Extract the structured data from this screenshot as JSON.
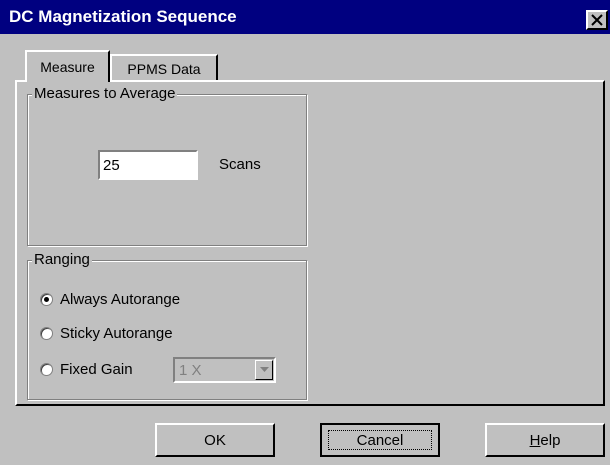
{
  "window": {
    "title": "DC Magnetization Sequence",
    "close_icon": "close-icon"
  },
  "tabs": [
    {
      "label": "Measure",
      "active": true
    },
    {
      "label": "PPMS Data",
      "active": false
    }
  ],
  "measures": {
    "group_label": "Measures to Average",
    "value": "25",
    "unit": "Scans"
  },
  "ranging": {
    "group_label": "Ranging",
    "options": [
      {
        "label": "Always Autorange",
        "checked": true
      },
      {
        "label": "Sticky Autorange",
        "checked": false
      },
      {
        "label": "Fixed Gain",
        "checked": false
      }
    ],
    "gain_value": "1 X",
    "gain_enabled": false
  },
  "buttons": {
    "ok": "OK",
    "cancel": "Cancel",
    "help_mnemonic": "H",
    "help_rest": "elp"
  },
  "colors": {
    "title_bar": "#000080",
    "face": "#c0c0c0"
  }
}
